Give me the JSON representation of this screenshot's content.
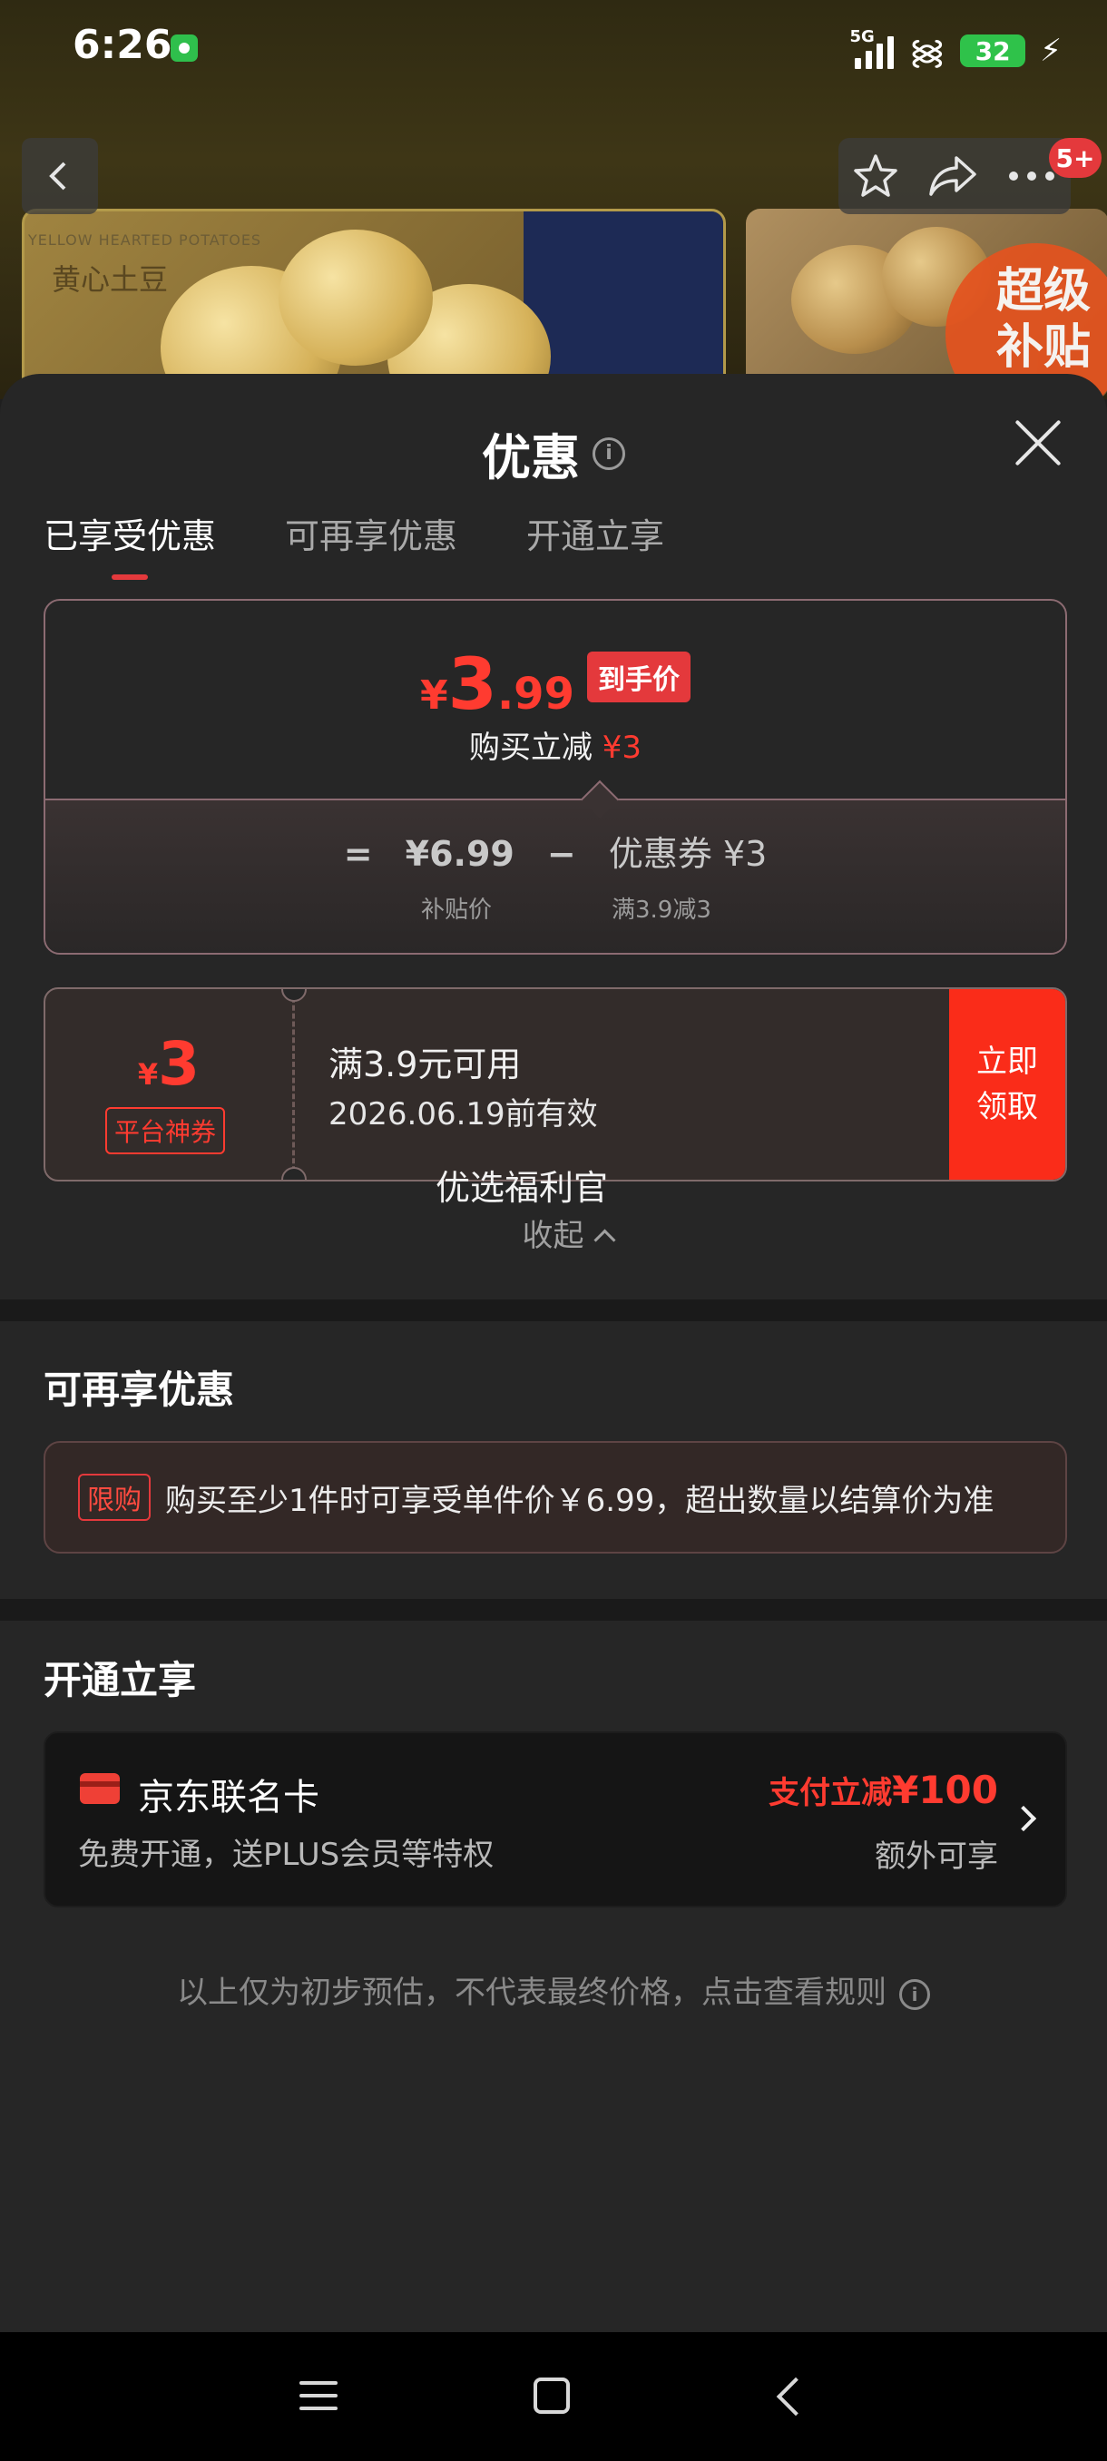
{
  "status_bar": {
    "time": "6:26",
    "network": "5G",
    "wifi_badge": "6",
    "battery": "32"
  },
  "top_nav": {
    "message_badge": "5+",
    "icons": [
      "back-icon",
      "star-icon",
      "share-icon",
      "more-icon"
    ]
  },
  "product_images": {
    "tag_en": "YELLOW HEARTED POTATOES",
    "tag_cn": "黄心土豆",
    "promo_badge_line1": "超级",
    "promo_badge_line2": "补贴"
  },
  "sheet": {
    "title": "优惠",
    "tabs": [
      "已享受优惠",
      "可再享优惠",
      "开通立享"
    ],
    "active_tab": 0
  },
  "price_card": {
    "currency": "¥",
    "price_int": "3",
    "price_dec": ".99",
    "price_tag": "到手价",
    "cut_text": "购买立减",
    "cut_amount": "¥3",
    "formula": {
      "eq": "=",
      "base": "¥6.99",
      "minus": "−",
      "coupon": "优惠券 ¥3",
      "base_label": "补贴价",
      "coupon_label": "满3.9减3"
    }
  },
  "coupon": {
    "currency": "¥",
    "amount": "3",
    "type": "平台神券",
    "condition": "满3.9元可用",
    "valid": "2026.06.19前有效",
    "button": "立即领取"
  },
  "welfare_label": "优选福利官",
  "collapse_label": "收起",
  "extra_section": {
    "title": "可再享优惠",
    "limit_tag": "限购",
    "limit_text": "购买至少1件时可享受单件价￥6.99，超出数量以结算价为准"
  },
  "open_section": {
    "title": "开通立享",
    "card_name": "京东联名卡",
    "card_sub": "免费开通，送PLUS会员等特权",
    "pay_prefix": "支付立减",
    "pay_amount": "¥100",
    "extra": "额外可享"
  },
  "disclaimer": "以上仅为初步预估，不代表最终价格，点击查看规则",
  "colors": {
    "accent": "#ff3b30",
    "background": "#262626",
    "coupon_button": "#fa2c19"
  }
}
